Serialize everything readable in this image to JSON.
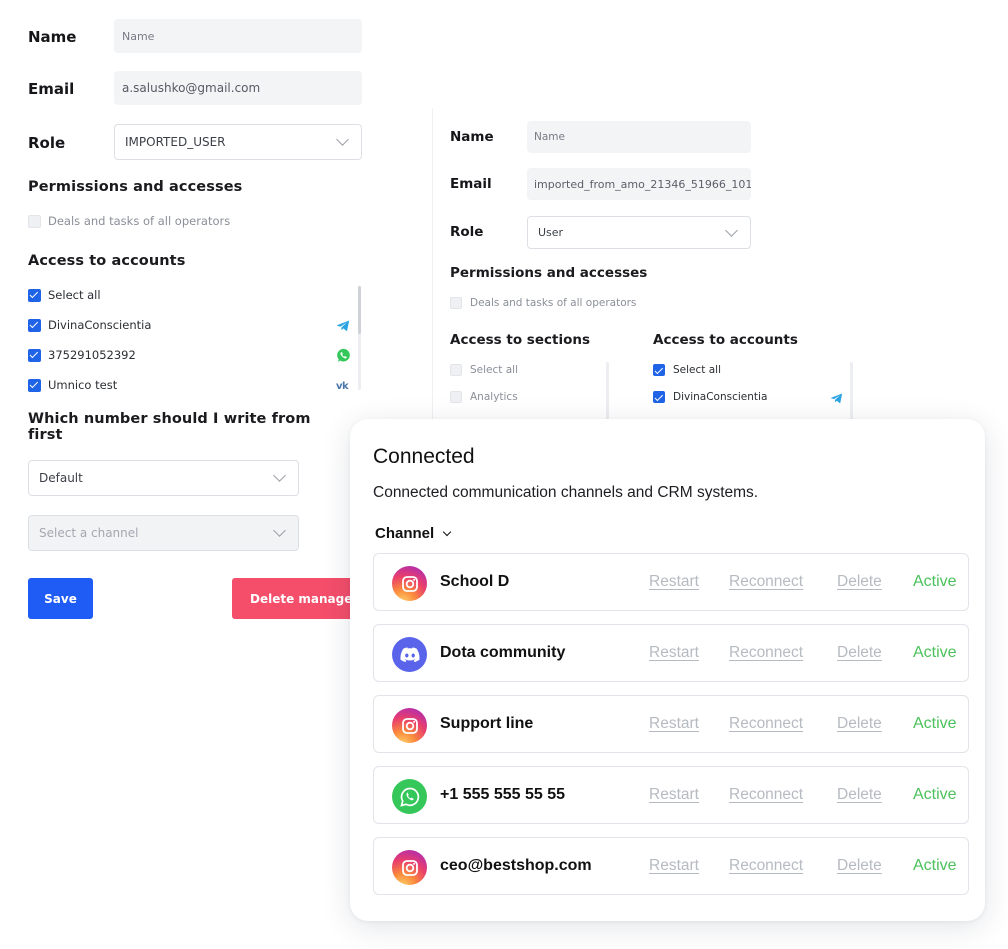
{
  "panel1": {
    "name_label": "Name",
    "name_placeholder": "Name",
    "email_label": "Email",
    "email_value": "a.salushko@gmail.com",
    "role_label": "Role",
    "role_value": "IMPORTED_USER",
    "permissions_title": "Permissions and accesses",
    "deals_label": "Deals and tasks of all operators",
    "accounts_title": "Access to accounts",
    "accounts": [
      {
        "label": "Select all",
        "checked": true,
        "icon": ""
      },
      {
        "label": "DivinaConscientia",
        "checked": true,
        "icon": "telegram-icon"
      },
      {
        "label": "375291052392",
        "checked": true,
        "icon": "whatsapp-icon"
      },
      {
        "label": "Umnico test",
        "checked": true,
        "icon": "vk-icon"
      }
    ],
    "number_question_line1": "Which number should I write from",
    "number_question_line2": "first",
    "number_default": "Default",
    "channel_placeholder": "Select a channel",
    "save_label": "Save",
    "delete_label": "Delete manager"
  },
  "panel2": {
    "name_label": "Name",
    "name_placeholder": "Name",
    "email_label": "Email",
    "email_value": "imported_from_amo_21346_51966_101",
    "role_label": "Role",
    "role_value": "User",
    "permissions_title": "Permissions and accesses",
    "deals_label": "Deals and tasks of all operators",
    "sections_title": "Access to sections",
    "sections": [
      {
        "label": "Select all",
        "checked": false
      },
      {
        "label": "Analytics",
        "checked": false
      }
    ],
    "accounts_title": "Access to accounts",
    "accounts": [
      {
        "label": "Select all",
        "checked": true
      },
      {
        "label": "DivinaConscientia",
        "checked": true,
        "icon": "telegram-icon"
      }
    ]
  },
  "connected": {
    "title": "Connected",
    "subtitle": "Connected communication channels and CRM systems.",
    "channel_header": "Channel",
    "actions": {
      "restart": "Restart",
      "reconnect": "Reconnect",
      "delete": "Delete"
    },
    "status_color": "#4cc15c",
    "rows": [
      {
        "name": "School D",
        "icon": "instagram-icon",
        "status": "Active"
      },
      {
        "name": "Dota community",
        "icon": "discord-icon",
        "status": "Active"
      },
      {
        "name": "Support line",
        "icon": "instagram-icon",
        "status": "Active"
      },
      {
        "name": "+1 555 555 55 55",
        "icon": "whatsapp-icon",
        "status": "Active"
      },
      {
        "name": "ceo@bestshop.com",
        "icon": "instagram-icon",
        "status": "Active"
      }
    ]
  },
  "colors": {
    "primary": "#1f5cf5",
    "danger": "#f44e6b",
    "checkbox": "#1f63e6"
  }
}
